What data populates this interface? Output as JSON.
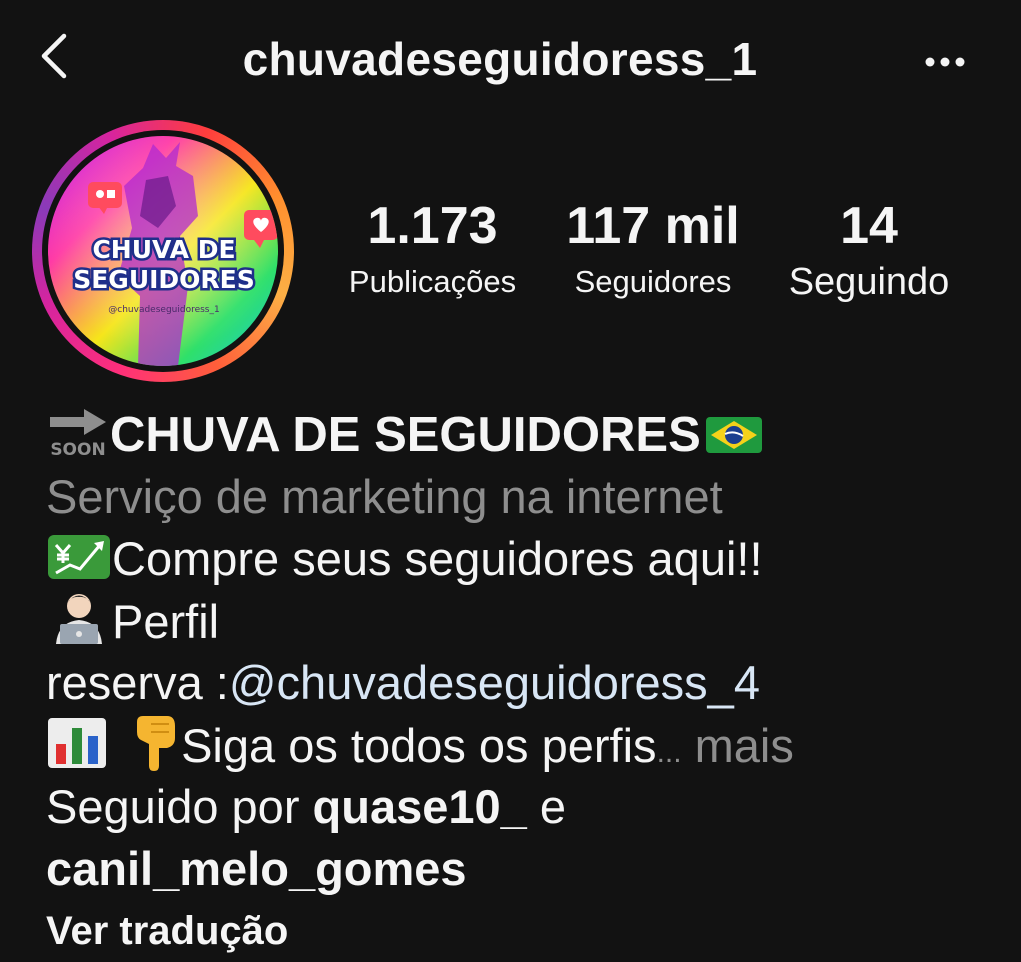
{
  "header": {
    "username": "chuvadeseguidoress_1"
  },
  "avatar": {
    "line1": "CHUVA DE",
    "line2": "SEGUIDORES",
    "handle": "@chuvadeseguidoress_1"
  },
  "stats": [
    {
      "value": "1.173",
      "label": "Publicações"
    },
    {
      "value": "117 mil",
      "label": "Seguidores"
    },
    {
      "value": "14",
      "label": "Seguindo"
    }
  ],
  "bio": {
    "soon_text": "SOON",
    "name": "CHUVA DE SEGUIDORES",
    "category": "Serviço de marketing na internet",
    "line_compre": "Compre seus seguidores aqui!!",
    "line_perfil": "Perfil",
    "line_reserva": "reserva :",
    "reserva_link": "@chuvadeseguidoress_4",
    "line_siga": "Siga os todos os perfis",
    "ellipsis": "...",
    "more": " mais"
  },
  "followed_by": {
    "prefix": "Seguido por ",
    "user1": "quase10_",
    "conj": " e",
    "user2": "canil_melo_gomes"
  },
  "translate": "Ver tradução",
  "icons": {
    "back": "chevron-left-icon",
    "more": "more-dots-icon",
    "soon": "soon-arrow-emoji",
    "flag": "brazil-flag-emoji",
    "chart": "chart-yen-emoji",
    "technologist": "technologist-emoji",
    "bar_chart": "bar-chart-emoji",
    "point_down": "pointing-down-emoji"
  },
  "colors": {
    "background": "#121212",
    "text": "#f5f5f5",
    "muted": "#8e8e8e",
    "link": "#d8e6f5"
  }
}
